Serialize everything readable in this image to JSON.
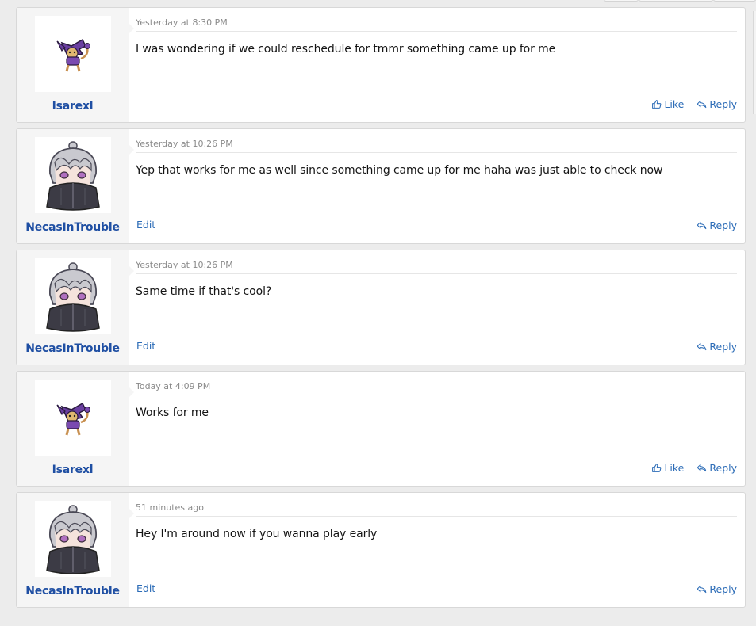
{
  "posts": [
    {
      "username": "Isarexl",
      "avatar_icon": "purple-pokemon-avatar",
      "timestamp": "Yesterday at 8:30 PM",
      "message": "I was wondering if we could reschedule for tmmr something came up for me",
      "actions": {
        "like": "Like",
        "reply": "Reply"
      }
    },
    {
      "username": "NecasInTrouble",
      "avatar_icon": "anime-character-avatar",
      "timestamp": "Yesterday at 10:26 PM",
      "message": "Yep that works for me as well since something came up for me haha was just able to check now",
      "actions": {
        "edit": "Edit",
        "reply": "Reply"
      }
    },
    {
      "username": "NecasInTrouble",
      "avatar_icon": "anime-character-avatar",
      "timestamp": "Yesterday at 10:26 PM",
      "message": "Same time if that's cool?",
      "actions": {
        "edit": "Edit",
        "reply": "Reply"
      }
    },
    {
      "username": "Isarexl",
      "avatar_icon": "purple-pokemon-avatar",
      "timestamp": "Today at 4:09 PM",
      "message": "Works for me",
      "actions": {
        "like": "Like",
        "reply": "Reply"
      }
    },
    {
      "username": "NecasInTrouble",
      "avatar_icon": "anime-character-avatar",
      "timestamp": "51 minutes ago",
      "message": "Hey I'm around now if you wanna play early",
      "actions": {
        "edit": "Edit",
        "reply": "Reply"
      }
    }
  ],
  "colors": {
    "link": "#2c6cb7",
    "username": "#1f4fa3",
    "user_cell_bg": "#f5f5f5"
  }
}
